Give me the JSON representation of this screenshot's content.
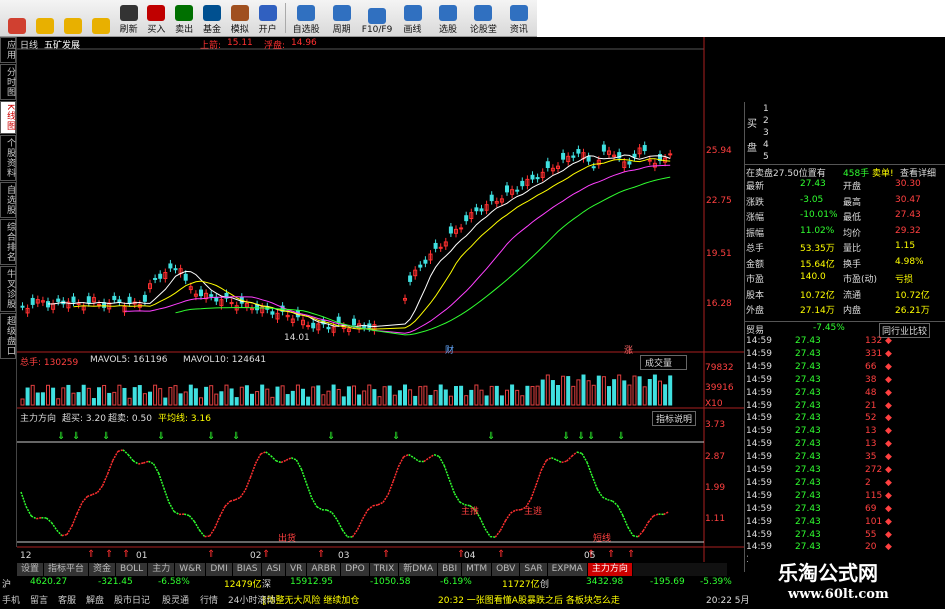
{
  "toolbar": {
    "buttons": [
      {
        "label": "",
        "icon": "grid-icon",
        "color": "#d04030"
      },
      {
        "label": "",
        "icon": "back-arrow-icon",
        "color": "#e8b000"
      },
      {
        "label": "",
        "icon": "updown-arrow-icon",
        "color": "#e8b000"
      },
      {
        "label": "",
        "icon": "refresh-icon",
        "color": "#e8b000"
      },
      {
        "label": "刷新",
        "icon": "clock-icon",
        "color": "#333"
      },
      {
        "label": "买入",
        "icon": "buy-icon",
        "color": "#c00000"
      },
      {
        "label": "卖出",
        "icon": "sell-icon",
        "color": "#007000"
      },
      {
        "label": "基金",
        "icon": "fund-icon",
        "color": "#005090"
      },
      {
        "label": "模拟",
        "icon": "hammer-icon",
        "color": "#a05020"
      },
      {
        "label": "开户",
        "icon": "account-icon",
        "color": "#3060c0"
      },
      {
        "label": "自选股",
        "icon": "star-folder-icon",
        "color": "#3070c0"
      },
      {
        "label": "周期",
        "icon": "cycle-icon",
        "color": "#3070c0"
      },
      {
        "label": "F10/F9",
        "icon": "f10-icon",
        "color": "#3070c0"
      },
      {
        "label": "画线",
        "icon": "draw-line-icon",
        "color": "#3070c0"
      },
      {
        "label": "选股",
        "icon": "select-stock-icon",
        "color": "#3070c0"
      },
      {
        "label": "论股堂",
        "icon": "forum-icon",
        "color": "#3070c0"
      },
      {
        "label": "资讯",
        "icon": "info-icon",
        "color": "#3070c0"
      }
    ]
  },
  "chart_header": {
    "period": "日线",
    "name": "五矿发展",
    "up_label": "上箭:",
    "up_value": "15.11",
    "down_label": "浮盘:",
    "down_value": "14.96"
  },
  "left_tabs": [
    "应用",
    "分时图",
    "K线图",
    "个股资料",
    "自选股",
    "综合排名",
    "牛叉诊股",
    "超级盘口"
  ],
  "price_axis": [
    "25.94",
    "22.75",
    "19.51",
    "16.28"
  ],
  "low_label": "14.01",
  "markers": {
    "m1": "财",
    "m2": "涨"
  },
  "volume_header": {
    "total": "总手: 130259",
    "mavol5": "MAVOL5: 161196",
    "mavol10": "MAVOL10: 124641",
    "dropdown": "成交量"
  },
  "volume_axis": [
    "79832",
    "39916",
    "X10"
  ],
  "indicator_header": {
    "name": "主力方向",
    "sell": "超买: 3.20",
    "buy": "超卖: 0.50",
    "avg": "平均线: 3.16",
    "button": "指标说明"
  },
  "indicator_axis": [
    "3.73",
    "2.87",
    "1.99",
    "1.11"
  ],
  "indicator_labels": [
    "主推",
    "主逃",
    "出货",
    "短线"
  ],
  "date_labels": [
    "12",
    "01",
    "02",
    "03",
    "04",
    "05"
  ],
  "tabs": [
    "设置",
    "指标平台",
    "资金",
    "BOLL",
    "主力",
    "W&R",
    "DMI",
    "BIAS",
    "ASI",
    "VR",
    "ARBR",
    "DPO",
    "TRIX",
    "新DMA",
    "BBI",
    "MTM",
    "OBV",
    "SAR",
    "EXPMA",
    "主力方向"
  ],
  "quote": {
    "buy_label": "买",
    "pan_label": "盘",
    "levels": [
      "1",
      "2",
      "3",
      "4",
      "5"
    ],
    "header": "在卖盘27.50位置有",
    "header_hands": "458手",
    "header_sell": "卖单!",
    "header_link": "查看详细",
    "rows": [
      {
        "l": "最新",
        "v": "27.43",
        "l2": "开盘",
        "v2": "30.30"
      },
      {
        "l": "涨跌",
        "v": "-3.05",
        "l2": "最高",
        "v2": "30.47"
      },
      {
        "l": "涨幅",
        "v": "-10.01%",
        "l2": "最低",
        "v2": "27.43"
      },
      {
        "l": "振幅",
        "v": "11.02%",
        "l2": "均价",
        "v2": "29.32"
      },
      {
        "l": "总手",
        "v": "53.35万",
        "l2": "量比",
        "v2": "1.15"
      },
      {
        "l": "金额",
        "v": "15.64亿",
        "l2": "换手",
        "v2": "4.98%"
      },
      {
        "l": "市盈",
        "v": "140.0",
        "l2": "市盈(动)",
        "v2": "亏损"
      },
      {
        "l": "股本",
        "v": "10.72亿",
        "l2": "流通",
        "v2": "10.72亿"
      },
      {
        "l": "外盘",
        "v": "27.14万",
        "l2": "内盘",
        "v2": "26.21万"
      }
    ],
    "trade_label": "贸易",
    "trade_pct": "-7.45%",
    "trade_link": "同行业比较",
    "ticks": [
      {
        "t": "14:59",
        "p": "27.43",
        "v": "132"
      },
      {
        "t": "14:59",
        "p": "27.43",
        "v": "331"
      },
      {
        "t": "14:59",
        "p": "27.43",
        "v": "66"
      },
      {
        "t": "14:59",
        "p": "27.43",
        "v": "38"
      },
      {
        "t": "14:59",
        "p": "27.43",
        "v": "48"
      },
      {
        "t": "14:59",
        "p": "27.43",
        "v": "21"
      },
      {
        "t": "14:59",
        "p": "27.43",
        "v": "52"
      },
      {
        "t": "14:59",
        "p": "27.43",
        "v": "13"
      },
      {
        "t": "14:59",
        "p": "27.43",
        "v": "13"
      },
      {
        "t": "14:59",
        "p": "27.43",
        "v": "35"
      },
      {
        "t": "14:59",
        "p": "27.43",
        "v": "272"
      },
      {
        "t": "14:59",
        "p": "27.43",
        "v": "2"
      },
      {
        "t": "14:59",
        "p": "27.43",
        "v": "115"
      },
      {
        "t": "14:59",
        "p": "27.43",
        "v": "69"
      },
      {
        "t": "14:59",
        "p": "27.43",
        "v": "101"
      },
      {
        "t": "14:59",
        "p": "27.43",
        "v": "55"
      },
      {
        "t": "14:59",
        "p": "27.43",
        "v": "20"
      },
      {
        "t": "14:59",
        "p": "27.43",
        "v": "2"
      }
    ]
  },
  "status1": {
    "sh_label": "沪",
    "sh_index": "4620.27",
    "sh_change": "-321.45",
    "sh_pct": "-6.58%",
    "sh_amount": "12479亿",
    "sz_label": "深",
    "sz_index": "15912.95",
    "sz_change": "-1050.58",
    "sz_pct": "-6.19%",
    "cy_amount": "11727亿",
    "cy_label": "创",
    "cy_index": "3432.98",
    "cy_change": "-195.69",
    "cy_pct": "-5.39%"
  },
  "status2": {
    "items": [
      "手机",
      "留言",
      "客服",
      "解盘",
      "股市日记",
      "股灵通",
      "行情",
      "24小时滚动"
    ],
    "news": "‖体整无大风险 继续加仓",
    "news2": "20:32 一张图看懂A股暴跌之后 各板块怎么走",
    "time": "20:22 5月"
  },
  "brand": {
    "name": "乐淘公式网",
    "url": "www.60lt.com"
  },
  "colors": {
    "up": "#ff3030",
    "down": "#30ff30",
    "vol_up": "#e04040",
    "vol_down": "#40e0e0",
    "accent": "#ffff00"
  }
}
